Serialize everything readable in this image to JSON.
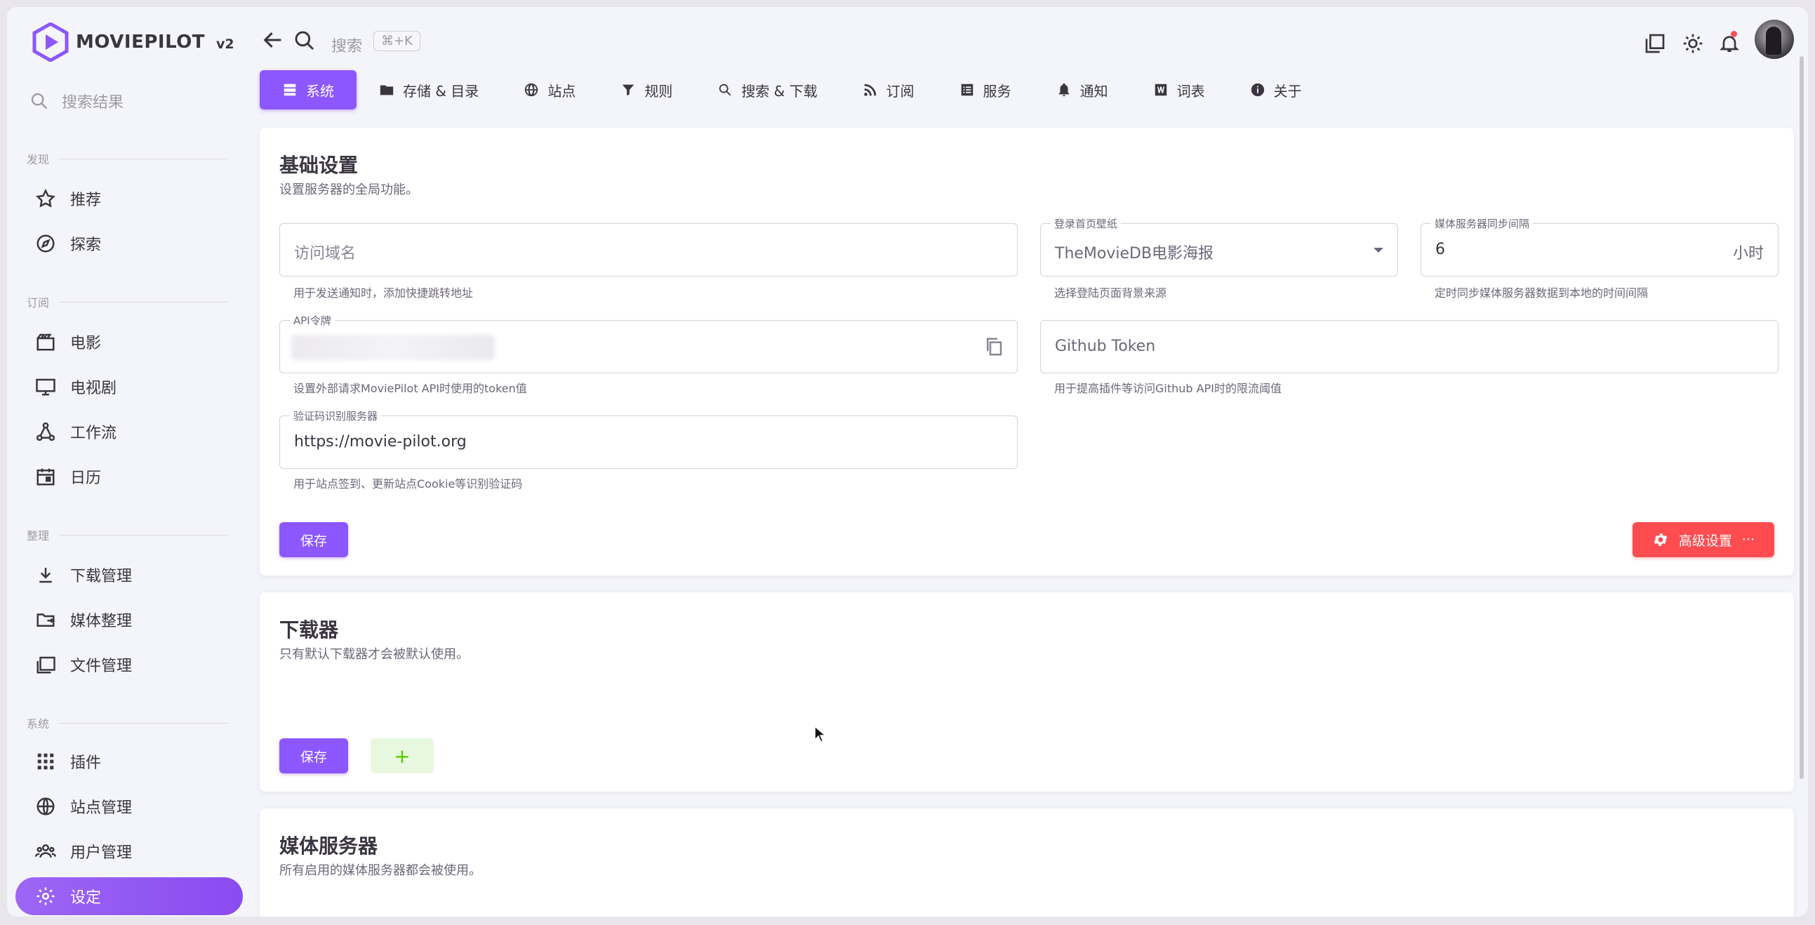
{
  "app": {
    "brand": "MOVIEPILOT",
    "version": "v2"
  },
  "sidebar": {
    "search_placeholder": "搜索结果",
    "sections": {
      "discover": "发现",
      "subscribe": "订阅",
      "organize": "整理",
      "system": "系统"
    },
    "items": [
      {
        "label": "推荐",
        "icon": "star-icon"
      },
      {
        "label": "探索",
        "icon": "compass-icon"
      },
      {
        "label": "电影",
        "icon": "movie-icon"
      },
      {
        "label": "电视剧",
        "icon": "tv-icon"
      },
      {
        "label": "工作流",
        "icon": "workflow-icon"
      },
      {
        "label": "日历",
        "icon": "calendar-icon"
      },
      {
        "label": "下载管理",
        "icon": "download-icon"
      },
      {
        "label": "媒体整理",
        "icon": "folder-move-icon"
      },
      {
        "label": "文件管理",
        "icon": "file-manager-icon"
      },
      {
        "label": "插件",
        "icon": "apps-grid-icon"
      },
      {
        "label": "站点管理",
        "icon": "globe-icon"
      },
      {
        "label": "用户管理",
        "icon": "users-icon"
      },
      {
        "label": "设定",
        "icon": "gear-icon",
        "active": true
      }
    ]
  },
  "header": {
    "search_placeholder": "搜索",
    "shortcut": "⌘+K"
  },
  "tabs": [
    {
      "label": "系统",
      "icon": "server-icon",
      "active": true
    },
    {
      "label": "存储 & 目录",
      "icon": "folder-icon"
    },
    {
      "label": "站点",
      "icon": "globe-icon"
    },
    {
      "label": "规则",
      "icon": "filter-icon"
    },
    {
      "label": "搜索 & 下载",
      "icon": "search-icon"
    },
    {
      "label": "订阅",
      "icon": "rss-icon"
    },
    {
      "label": "服务",
      "icon": "list-icon"
    },
    {
      "label": "通知",
      "icon": "bell-icon"
    },
    {
      "label": "词表",
      "icon": "word-icon"
    },
    {
      "label": "关于",
      "icon": "info-icon"
    }
  ],
  "basic": {
    "title": "基础设置",
    "subtitle": "设置服务器的全局功能。",
    "domain": {
      "placeholder": "访问域名",
      "hint": "用于发送通知时，添加快捷跳转地址"
    },
    "wallpaper": {
      "label": "登录首页壁纸",
      "value": "TheMovieDB电影海报",
      "hint": "选择登陆页面背景来源"
    },
    "sync": {
      "label": "媒体服务器同步间隔",
      "value": "6",
      "suffix": "小时",
      "hint": "定时同步媒体服务器数据到本地的时间间隔"
    },
    "api_token": {
      "label": "API令牌",
      "hint": "设置外部请求MoviePilot API时使用的token值"
    },
    "github": {
      "placeholder": "Github Token",
      "hint": "用于提高插件等访问Github API时的限流阈值"
    },
    "ocr": {
      "label": "验证码识别服务器",
      "value": "https://movie-pilot.org",
      "hint": "用于站点签到、更新站点Cookie等识别验证码"
    },
    "save": "保存",
    "advanced": "高级设置",
    "more": "···"
  },
  "downloader": {
    "title": "下载器",
    "subtitle": "只有默认下载器才会被默认使用。",
    "save": "保存",
    "add": "+"
  },
  "media_server": {
    "title": "媒体服务器",
    "subtitle": "所有启用的媒体服务器都会被使用。"
  },
  "colors": {
    "primary": "#8c57ff",
    "danger": "#ff4c51",
    "success": "#56ca00"
  }
}
